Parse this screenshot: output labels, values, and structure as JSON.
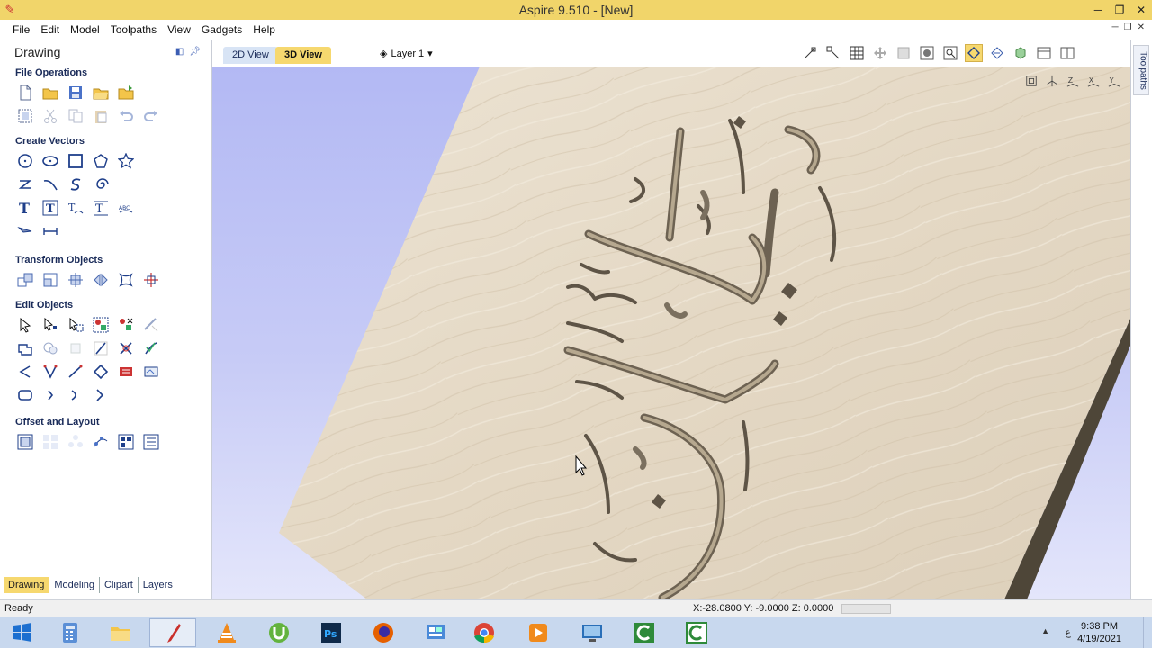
{
  "window": {
    "title": "Aspire 9.510 - [New]"
  },
  "menu": [
    "File",
    "Edit",
    "Model",
    "Toolpaths",
    "View",
    "Gadgets",
    "Help"
  ],
  "left_panel": {
    "title": "Drawing",
    "sections": {
      "file_operations": "File Operations",
      "create_vectors": "Create Vectors",
      "transform_objects": "Transform Objects",
      "edit_objects": "Edit Objects",
      "offset_and_layout": "Offset and Layout"
    },
    "bottom_tabs": [
      "Drawing",
      "Modeling",
      "Clipart",
      "Layers"
    ]
  },
  "view_tabs": {
    "tab_2d": "2D View",
    "tab_3d": "3D View",
    "layer": "Layer 1"
  },
  "right_strip": {
    "label": "Toolpaths"
  },
  "status": {
    "ready": "Ready",
    "coords": "X:-28.0800 Y: -9.0000 Z:  0.0000"
  },
  "taskbar": {
    "time": "9:38 PM",
    "date": "4/19/2021",
    "lang": "ع"
  },
  "colors": {
    "titlebar": "#f1d56a",
    "active_tab": "#f6d86f",
    "sky": "#b3b9f4",
    "wood": "#e6dccd"
  }
}
